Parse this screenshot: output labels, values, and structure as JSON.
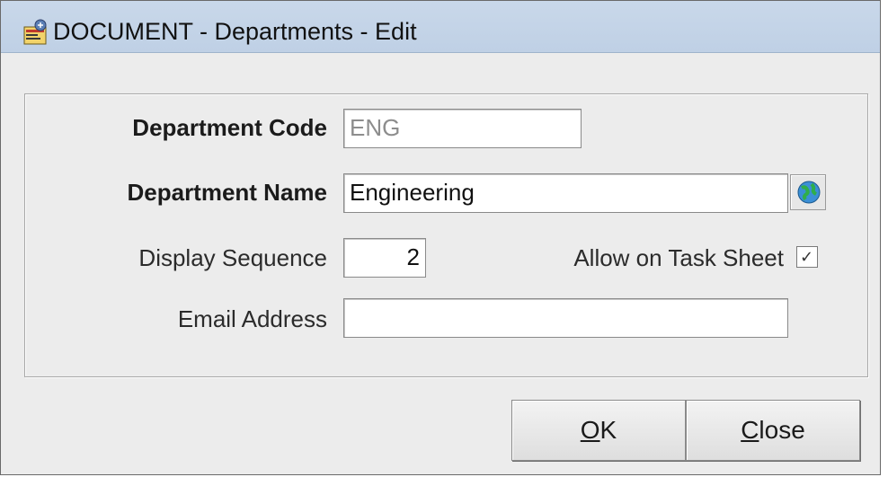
{
  "window": {
    "title": "DOCUMENT - Departments  - Edit",
    "title_icon": "application-icon"
  },
  "form": {
    "department_code": {
      "label": "Department Code",
      "value": "ENG"
    },
    "department_name": {
      "label": "Department Name",
      "value": "Engineering",
      "lookup_icon": "globe-icon"
    },
    "display_sequence": {
      "label": "Display Sequence",
      "value": "2"
    },
    "allow_on_task_sheet": {
      "label": "Allow on Task Sheet",
      "checked": true
    },
    "email_address": {
      "label": "Email Address",
      "value": ""
    }
  },
  "buttons": {
    "ok": {
      "mnemonic": "O",
      "rest": "K"
    },
    "close": {
      "mnemonic": "C",
      "rest": "lose"
    }
  }
}
